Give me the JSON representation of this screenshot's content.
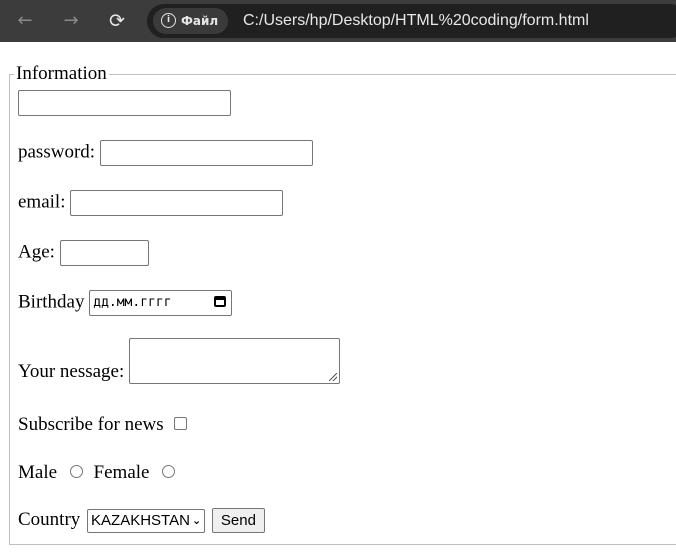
{
  "browser": {
    "back_icon": "←",
    "forward_icon": "→",
    "reload_icon": "⟳",
    "info_icon": "i",
    "site_chip": "Файл",
    "url": "C:/Users/hp/Desktop/HTML%20coding/form.html"
  },
  "form": {
    "legend": "Information",
    "password_label": "password:",
    "email_label": "email:",
    "age_label": "Age:",
    "birthday_label": "Birthday",
    "birthday_placeholder": "дд.мм.гггг",
    "message_label": "Your nessage:",
    "subscribe_label": "Subscribe for news",
    "male_label": "Male",
    "female_label": "Female",
    "country_label": "Country",
    "country_selected": "KAZAKHSTAN",
    "send_label": "Send"
  }
}
